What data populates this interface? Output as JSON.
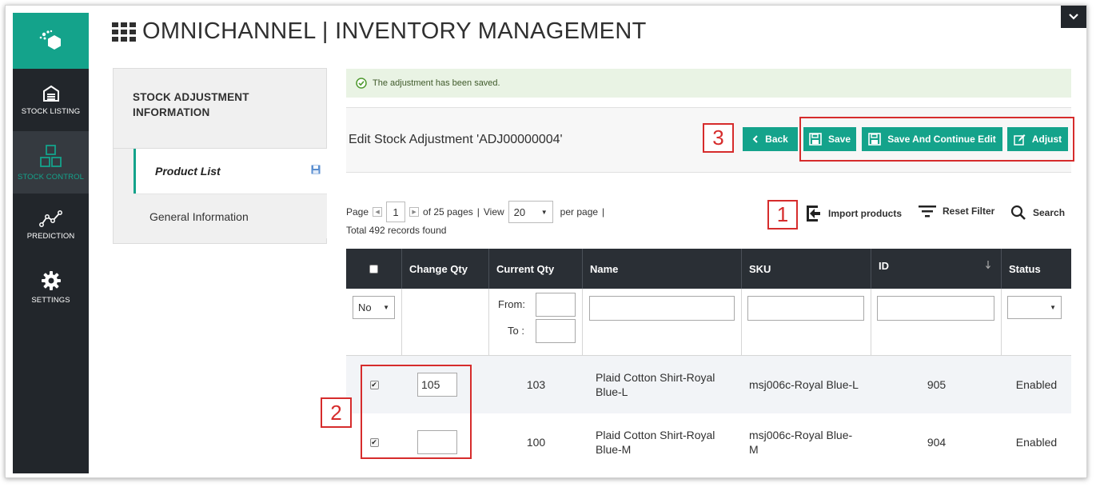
{
  "app": {
    "title": "OMNICHANNEL | INVENTORY MANAGEMENT"
  },
  "sidebar": {
    "items": [
      {
        "label": "STOCK LISTING",
        "icon": "warehouse-icon",
        "active": false
      },
      {
        "label": "STOCK CONTROL",
        "icon": "boxes-icon",
        "active": true
      },
      {
        "label": "PREDICTION",
        "icon": "trend-icon",
        "active": false
      },
      {
        "label": "SETTINGS",
        "icon": "gear-icon",
        "active": false
      }
    ]
  },
  "tabs": {
    "title": "STOCK ADJUSTMENT INFORMATION",
    "items": [
      {
        "label": "Product List",
        "active": true
      },
      {
        "label": "General Information",
        "active": false
      }
    ]
  },
  "message": {
    "text": "The adjustment has been saved."
  },
  "actions": {
    "title": "Edit Stock Adjustment 'ADJ00000004'",
    "back": "Back",
    "save": "Save",
    "save_continue": "Save And Continue Edit",
    "adjust": "Adjust"
  },
  "callouts": {
    "one": "1",
    "two": "2",
    "three": "3"
  },
  "pager": {
    "page_label": "Page",
    "page_value": "1",
    "of_pages": "of 25 pages",
    "sep": "|",
    "view_label": "View",
    "view_value": "20",
    "per_page": "per page",
    "sep2": "|",
    "records": "Total 492 records found"
  },
  "tools": {
    "import": "Import products",
    "reset": "Reset Filter",
    "search": "Search"
  },
  "grid": {
    "columns": [
      "",
      "Change Qty",
      "Current Qty",
      "Name",
      "SKU",
      "ID",
      "Status"
    ],
    "filters": {
      "select_value": "No",
      "from_label": "From:",
      "to_label": "To :",
      "status_value": ""
    },
    "rows": [
      {
        "checked": true,
        "change_qty": "105",
        "current_qty": "103",
        "name": "Plaid Cotton Shirt-Royal Blue-L",
        "sku": "msj006c-Royal Blue-L",
        "id": "905",
        "status": "Enabled"
      },
      {
        "checked": true,
        "change_qty": "",
        "current_qty": "100",
        "name": "Plaid Cotton Shirt-Royal Blue-M",
        "sku": "msj006c-Royal Blue-M",
        "id": "904",
        "status": "Enabled"
      }
    ]
  },
  "colors": {
    "accent": "#14a38b",
    "sidebar": "#22262b",
    "callout": "#d62c2c",
    "header": "#2a2f35"
  }
}
